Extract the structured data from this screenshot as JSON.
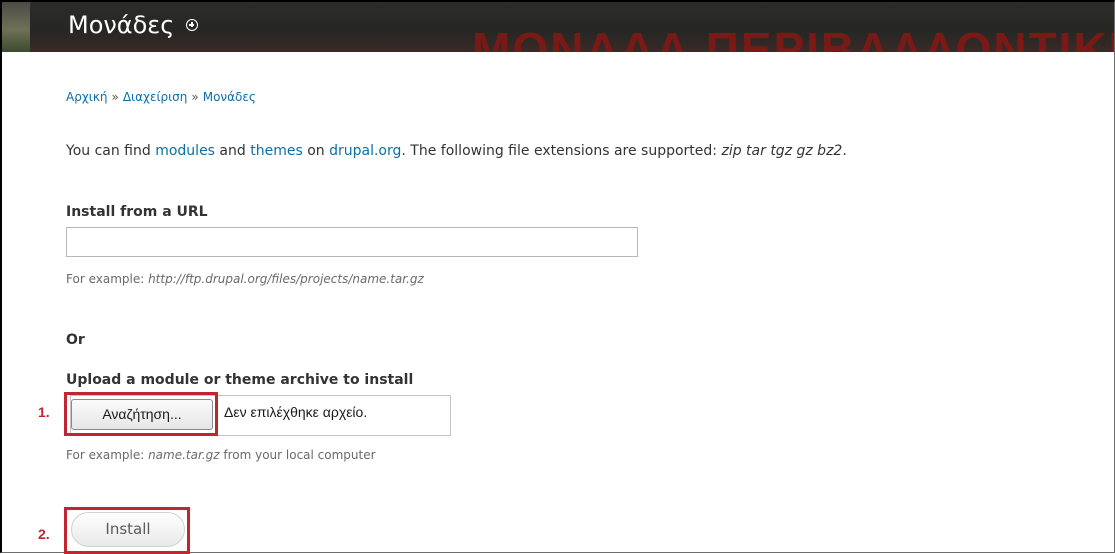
{
  "header": {
    "title": "Μονάδες",
    "background_text": "ΜΟΝΑΔΑ ΠΕΡΙΒΑΛΛΟΝΤΙΚΗΣ"
  },
  "breadcrumb": {
    "items": [
      "Αρχική",
      "Διαχείριση",
      "Μονάδες"
    ],
    "separator": "»"
  },
  "intro": {
    "prefix": "You can find ",
    "modules_link": "modules",
    "and": " and ",
    "themes_link": "themes",
    "on": " on ",
    "drupal_link": "drupal.org",
    "suffix": ". The following file extensions are supported: ",
    "extensions": "zip tar tgz gz bz2",
    "end": "."
  },
  "install_url": {
    "label": "Install from a URL",
    "value": "",
    "hint_prefix": "For example: ",
    "hint_example": "http://ftp.drupal.org/files/projects/name.tar.gz"
  },
  "or_label": "Or",
  "upload": {
    "label": "Upload a module or theme archive to install",
    "browse_label": "Αναζήτηση...",
    "no_file_text": "Δεν επιλέχθηκε αρχείο.",
    "hint_prefix": "For example: ",
    "hint_example": "name.tar.gz",
    "hint_suffix": " from your local computer"
  },
  "install_button_label": "Install",
  "annotations": {
    "step1": "1.",
    "step2": "2.",
    "highlight_color": "#c0262d"
  },
  "colors": {
    "link": "#0b6fa8",
    "header_bg": "#2c2d2b",
    "header_accent_red": "#7a1a16"
  }
}
